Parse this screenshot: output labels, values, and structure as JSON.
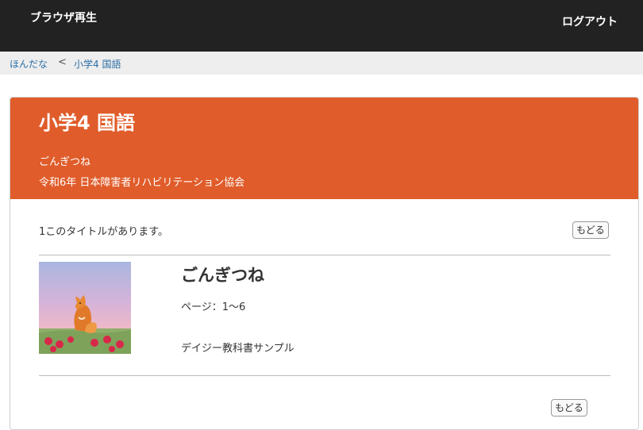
{
  "header": {
    "brand": "ブラウザ再生",
    "logout_label": "ログアウト"
  },
  "breadcrumb": {
    "home": "ほんだな",
    "separator": "<",
    "current": "小学4 国語"
  },
  "panel": {
    "title": "小学4 国語",
    "subtitle": "ごんぎつね",
    "publisher": "令和6年 日本障害者リハビリテーション協会",
    "count_text": "1このタイトルがあります。",
    "back_label": "もどる",
    "header_color": "#e05c2a"
  },
  "book": {
    "title": "ごんぎつね",
    "pages_label": "ページ：",
    "pages_value": "1〜6",
    "description": "デイジー教科書サンプル",
    "thumbnail_icon": "fox-illustration"
  }
}
